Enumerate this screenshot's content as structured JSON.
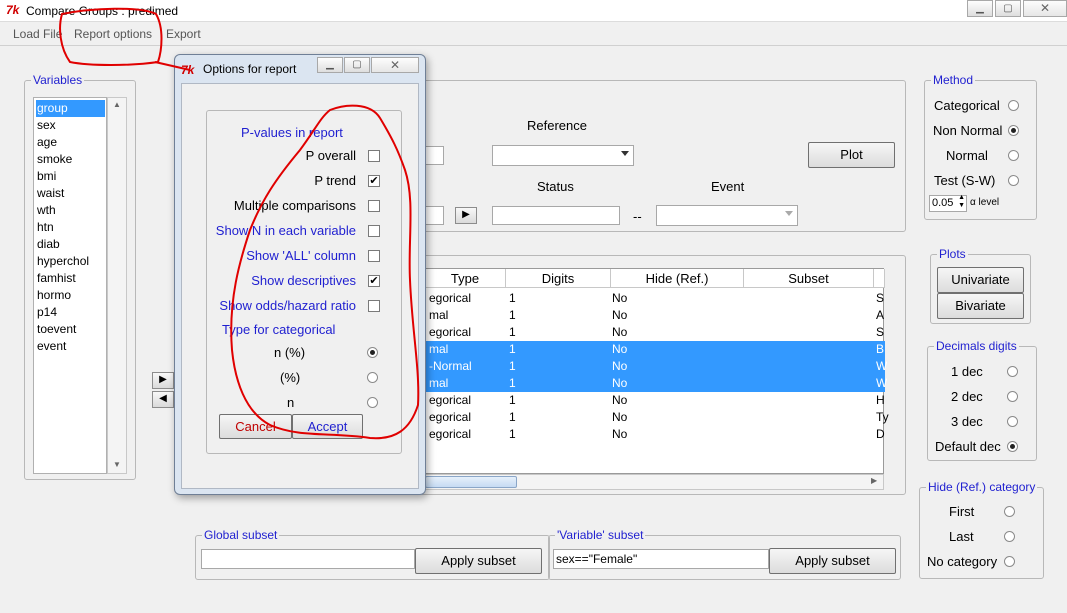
{
  "window": {
    "title": "Compare Groups : predimed"
  },
  "menu": {
    "items": [
      "Load File",
      "Report options",
      "Export"
    ]
  },
  "variables": {
    "title": "Variables",
    "items": [
      "group",
      "sex",
      "age",
      "smoke",
      "bmi",
      "waist",
      "wth",
      "htn",
      "diab",
      "hyperchol",
      "famhist",
      "hormo",
      "p14",
      "toevent",
      "event"
    ],
    "selected": "group"
  },
  "response": {
    "reference_label": "Reference",
    "status_label": "Status",
    "event_label": "Event",
    "dash": "--",
    "plot_button": "Plot"
  },
  "table": {
    "headers": [
      "Type",
      "Digits",
      "Hide (Ref.)",
      "Subset"
    ],
    "rows": [
      {
        "type": "egorical",
        "digits": "1",
        "hide": "No",
        "subset": "S"
      },
      {
        "type": "mal",
        "digits": "1",
        "hide": "No",
        "subset": "A"
      },
      {
        "type": "egorical",
        "digits": "1",
        "hide": "No",
        "subset": "S"
      },
      {
        "type": "mal",
        "digits": "1",
        "hide": "No",
        "subset": "B"
      },
      {
        "type": "-Normal",
        "digits": "1",
        "hide": "No",
        "subset": "W"
      },
      {
        "type": "mal",
        "digits": "1",
        "hide": "No",
        "subset": "W"
      },
      {
        "type": "egorical",
        "digits": "1",
        "hide": "No",
        "subset": "H"
      },
      {
        "type": "egorical",
        "digits": "1",
        "hide": "No",
        "subset": "Ty"
      },
      {
        "type": "egorical",
        "digits": "1",
        "hide": "No",
        "subset": "D"
      }
    ],
    "selected_rows": [
      3,
      4,
      5
    ]
  },
  "method": {
    "title": "Method",
    "options": [
      "Categorical",
      "Non Normal",
      "Normal",
      "Test (S-W)"
    ],
    "selected": "Non Normal",
    "alpha_value": "0.05",
    "alpha_label": "α level"
  },
  "plots": {
    "title": "Plots",
    "buttons": [
      "Univariate",
      "Bivariate"
    ]
  },
  "decimals": {
    "title": "Decimals digits",
    "options": [
      "1 dec",
      "2 dec",
      "3 dec",
      "Default dec"
    ],
    "selected": "Default dec"
  },
  "hide_category": {
    "title": "Hide (Ref.) category",
    "options": [
      "First",
      "Last",
      "No category"
    ]
  },
  "global_subset": {
    "title": "Global subset",
    "value": "",
    "button": "Apply subset"
  },
  "variable_subset": {
    "title": "'Variable' subset",
    "value": "sex==\"Female\"",
    "button": "Apply subset"
  },
  "dialog": {
    "title": "Options for report",
    "pvalues_title": "P-values in report",
    "options": [
      {
        "label": "P overall",
        "checked": false,
        "blue": false
      },
      {
        "label": "P trend",
        "checked": true,
        "blue": false
      },
      {
        "label": "Multiple comparisons",
        "checked": false,
        "blue": false
      },
      {
        "label": "Show N in each variable",
        "checked": false,
        "blue": true
      },
      {
        "label": "Show 'ALL' column",
        "checked": false,
        "blue": true
      },
      {
        "label": "Show descriptives",
        "checked": true,
        "blue": true
      },
      {
        "label": "Show odds/hazard ratio",
        "checked": false,
        "blue": true
      }
    ],
    "type_title": "Type for categorical",
    "type_options": [
      "n (%)",
      "(%)",
      "n"
    ],
    "type_selected": "n (%)",
    "cancel": "Cancel",
    "accept": "Accept"
  },
  "colors": {
    "accent": "#3399ff",
    "legend": "#1f1fd0",
    "annotation": "#e00000"
  }
}
